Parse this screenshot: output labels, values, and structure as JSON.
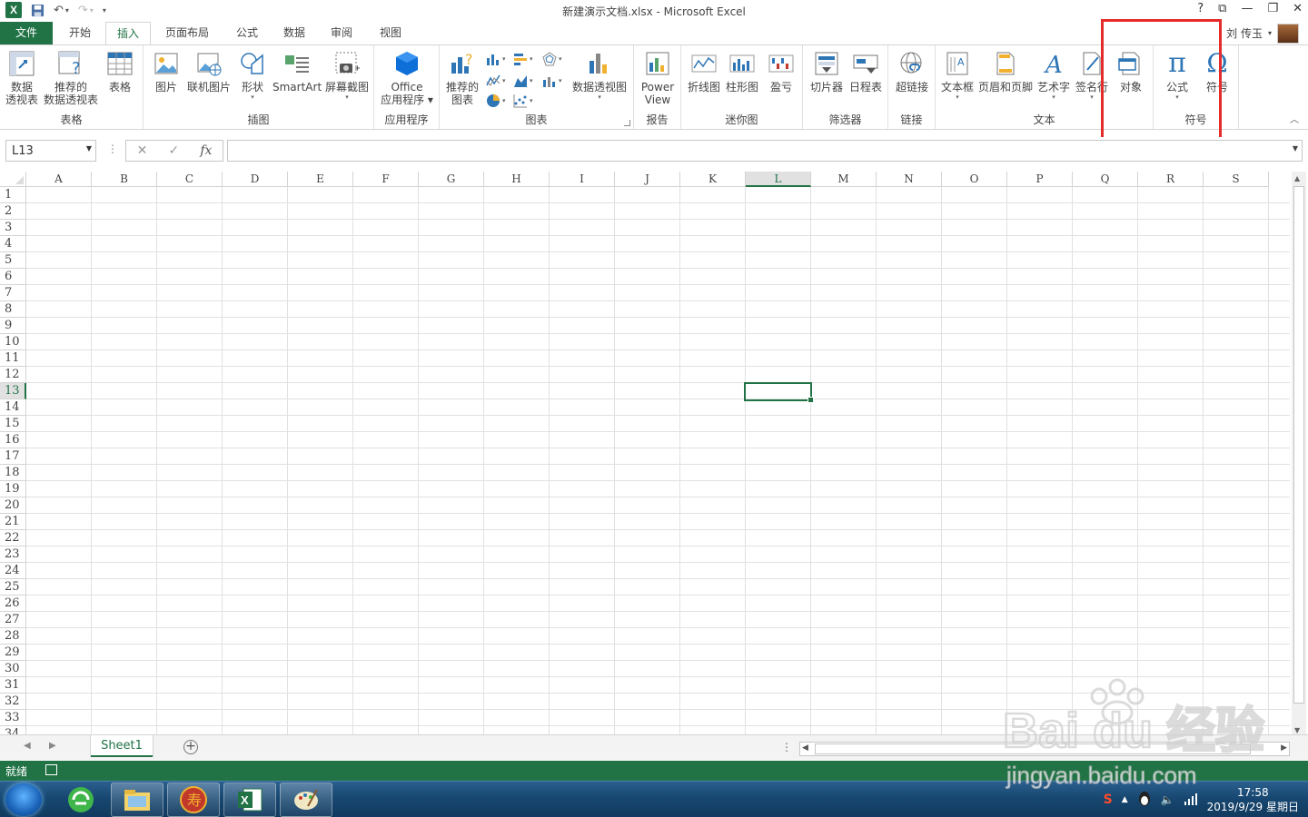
{
  "window": {
    "title": "新建演示文档.xlsx - Microsoft Excel",
    "controls": [
      "?",
      "⧉",
      "—",
      "❐",
      "✕"
    ]
  },
  "tabs": {
    "file": "文件",
    "items": [
      "开始",
      "插入",
      "页面布局",
      "公式",
      "数据",
      "审阅",
      "视图"
    ],
    "active": "插入"
  },
  "user": {
    "name": "刘 传玉"
  },
  "ribbon": {
    "groups": {
      "tables": {
        "label": "表格",
        "pivot": [
          "数据",
          "透视表"
        ],
        "recommended_pivot": [
          "推荐的",
          "数据透视表"
        ],
        "table": "表格"
      },
      "illustrations": {
        "label": "插图",
        "picture": "图片",
        "online_picture": "联机图片",
        "shapes": "形状",
        "smartart": "SmartArt",
        "screenshot": "屏幕截图"
      },
      "apps": {
        "label": "应用程序",
        "office": [
          "Office",
          "应用程序"
        ]
      },
      "charts": {
        "label": "图表",
        "recommended": [
          "推荐的",
          "图表"
        ],
        "pivot_chart": "数据透视图"
      },
      "reports": {
        "label": "报告",
        "power_view": [
          "Power",
          "View"
        ]
      },
      "sparklines": {
        "label": "迷你图",
        "line": "折线图",
        "column": "柱形图",
        "win_loss": "盈亏"
      },
      "filters": {
        "label": "筛选器",
        "slicer": "切片器",
        "timeline": "日程表"
      },
      "links": {
        "label": "链接",
        "hyperlink": "超链接"
      },
      "text": {
        "label": "文本",
        "textbox": "文本框",
        "header_footer": "页眉和页脚",
        "wordart": "艺术字",
        "signature": "签名行",
        "object": "对象"
      },
      "symbols": {
        "label": "符号",
        "equation": "公式",
        "symbol": "符号"
      }
    }
  },
  "formula_bar": {
    "name_box": "L13",
    "fx": "fx",
    "value": ""
  },
  "grid": {
    "columns": [
      "A",
      "B",
      "C",
      "D",
      "E",
      "F",
      "G",
      "H",
      "I",
      "J",
      "K",
      "L",
      "M",
      "N",
      "O",
      "P",
      "Q",
      "R",
      "S"
    ],
    "rows": [
      "1",
      "2",
      "3",
      "4",
      "5",
      "6",
      "7",
      "8",
      "9",
      "10",
      "11",
      "12",
      "13",
      "14",
      "15",
      "16",
      "17",
      "18",
      "19",
      "20",
      "21",
      "22",
      "23",
      "24",
      "25",
      "26",
      "27",
      "28",
      "29",
      "30",
      "31",
      "32",
      "33",
      "34"
    ],
    "selected_column": "L",
    "selected_row": "13"
  },
  "sheets": {
    "tabs": [
      "Sheet1"
    ],
    "active": "Sheet1"
  },
  "status": {
    "ready": "就绪"
  },
  "taskbar": {
    "time": "17:58",
    "date": "2019/9/29 星期日"
  },
  "watermark": {
    "brand": "Bai du 经验",
    "url": "jingyan.baidu.com"
  },
  "colors": {
    "accent": "#217346",
    "highlight": "#e52b2b"
  }
}
